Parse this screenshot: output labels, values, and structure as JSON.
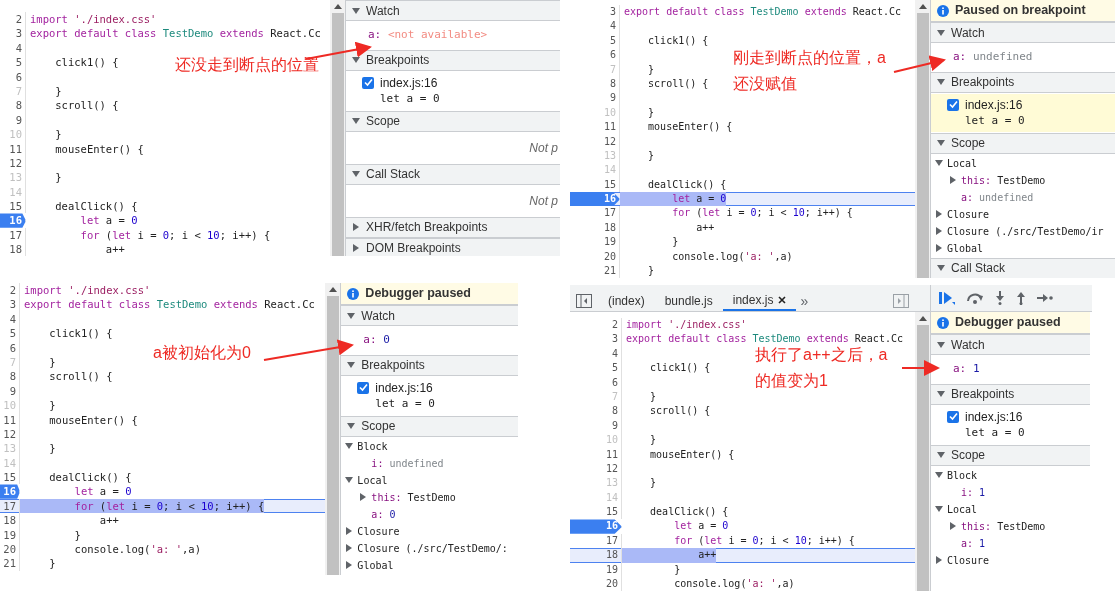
{
  "panels": [
    {
      "annotation": [
        "还没走到断点的位置"
      ],
      "code_lines": [
        {
          "number": "2",
          "dim": false,
          "breakpoint": false,
          "current": false,
          "code": [
            {
              "kind": "keyword",
              "text": "import "
            },
            {
              "kind": "string",
              "text": "'./index.css'"
            }
          ]
        },
        {
          "number": "3",
          "dim": false,
          "breakpoint": false,
          "current": false,
          "code": [
            {
              "kind": "keyword",
              "text": "export default class "
            },
            {
              "kind": "type",
              "text": "TestDemo "
            },
            {
              "kind": "keyword",
              "text": "extends "
            },
            {
              "kind": "plain",
              "text": "React.Cc"
            }
          ]
        },
        {
          "number": "4",
          "dim": false,
          "breakpoint": false,
          "current": false
        },
        {
          "number": "5",
          "dim": false,
          "breakpoint": false,
          "current": false,
          "code": [
            {
              "kind": "plain",
              "text": "    click1() {"
            }
          ]
        },
        {
          "number": "6",
          "dim": false,
          "breakpoint": false,
          "current": false
        },
        {
          "number": "7",
          "dim": true,
          "breakpoint": false,
          "current": false,
          "code": [
            {
              "kind": "plain",
              "text": "    }"
            }
          ]
        },
        {
          "number": "8",
          "dim": false,
          "breakpoint": false,
          "current": false,
          "code": [
            {
              "kind": "plain",
              "text": "    scroll() {"
            }
          ]
        },
        {
          "number": "9",
          "dim": false,
          "breakpoint": false,
          "current": false
        },
        {
          "number": "10",
          "dim": true,
          "breakpoint": false,
          "current": false,
          "code": [
            {
              "kind": "plain",
              "text": "    }"
            }
          ]
        },
        {
          "number": "11",
          "dim": false,
          "breakpoint": false,
          "current": false,
          "code": [
            {
              "kind": "plain",
              "text": "    mouseEnter() {"
            }
          ]
        },
        {
          "number": "12",
          "dim": false,
          "breakpoint": false,
          "current": false
        },
        {
          "number": "13",
          "dim": true,
          "breakpoint": false,
          "current": false,
          "code": [
            {
              "kind": "plain",
              "text": "    }"
            }
          ]
        },
        {
          "number": "14",
          "dim": true,
          "breakpoint": false,
          "current": false
        },
        {
          "number": "15",
          "dim": false,
          "breakpoint": false,
          "current": false,
          "code": [
            {
              "kind": "plain",
              "text": "    dealClick() {"
            }
          ]
        },
        {
          "number": "16",
          "dim": false,
          "breakpoint": true,
          "current": false,
          "code": [
            {
              "kind": "keyword",
              "text": "        let "
            },
            {
              "kind": "plain",
              "text": "a = "
            },
            {
              "kind": "number",
              "text": "0"
            }
          ]
        },
        {
          "number": "17",
          "dim": false,
          "breakpoint": false,
          "current": false,
          "code": [
            {
              "kind": "keyword",
              "text": "        for "
            },
            {
              "kind": "plain",
              "text": "("
            },
            {
              "kind": "keyword",
              "text": "let "
            },
            {
              "kind": "plain",
              "text": "i = "
            },
            {
              "kind": "number",
              "text": "0"
            },
            {
              "kind": "plain",
              "text": "; i < "
            },
            {
              "kind": "number",
              "text": "10"
            },
            {
              "kind": "plain",
              "text": "; i++) {"
            }
          ]
        },
        {
          "number": "18",
          "dim": false,
          "breakpoint": false,
          "current": false,
          "code": [
            {
              "kind": "plain",
              "text": "            a++"
            }
          ]
        }
      ],
      "sections": [
        {
          "title": "Watch",
          "expanded": true,
          "items": [
            {
              "kind": "watch",
              "name": "a:",
              "value": {
                "kind": "unavailable",
                "text": "<not available>"
              }
            }
          ]
        },
        {
          "title": "Breakpoints",
          "expanded": true,
          "items": [
            {
              "kind": "breakpoint",
              "checked": true,
              "file": "index.js:16",
              "code": "let a = 0",
              "selected": false
            }
          ]
        },
        {
          "title": "Scope",
          "expanded": true,
          "items": [
            {
              "kind": "message",
              "text": "Not p"
            }
          ]
        },
        {
          "title": "Call Stack",
          "expanded": true,
          "items": [
            {
              "kind": "message",
              "text": "Not p"
            }
          ]
        },
        {
          "title": "XHR/fetch Breakpoints",
          "expanded": false
        },
        {
          "title": "DOM Breakpoints",
          "expanded": false
        }
      ]
    },
    {
      "annotation": [
        "刚走到断点的位置，a",
        "还没赋值"
      ],
      "banner": "Paused on breakpoint",
      "code_lines": [
        {
          "number": "3",
          "dim": false,
          "breakpoint": false,
          "current": false,
          "code": [
            {
              "kind": "keyword",
              "text": "export default class "
            },
            {
              "kind": "type",
              "text": "TestDemo "
            },
            {
              "kind": "keyword",
              "text": "extends "
            },
            {
              "kind": "plain",
              "text": "React.Cc"
            }
          ]
        },
        {
          "number": "4",
          "dim": false,
          "breakpoint": false,
          "current": false
        },
        {
          "number": "5",
          "dim": false,
          "breakpoint": false,
          "current": false,
          "code": [
            {
              "kind": "plain",
              "text": "    click1() {"
            }
          ]
        },
        {
          "number": "6",
          "dim": false,
          "breakpoint": false,
          "current": false
        },
        {
          "number": "7",
          "dim": true,
          "breakpoint": false,
          "current": false,
          "code": [
            {
              "kind": "plain",
              "text": "    }"
            }
          ]
        },
        {
          "number": "8",
          "dim": false,
          "breakpoint": false,
          "current": false,
          "code": [
            {
              "kind": "plain",
              "text": "    scroll() {"
            }
          ]
        },
        {
          "number": "9",
          "dim": false,
          "breakpoint": false,
          "current": false
        },
        {
          "number": "10",
          "dim": true,
          "breakpoint": false,
          "current": false,
          "code": [
            {
              "kind": "plain",
              "text": "    }"
            }
          ]
        },
        {
          "number": "11",
          "dim": false,
          "breakpoint": false,
          "current": false,
          "code": [
            {
              "kind": "plain",
              "text": "    mouseEnter() {"
            }
          ]
        },
        {
          "number": "12",
          "dim": false,
          "breakpoint": false,
          "current": false
        },
        {
          "number": "13",
          "dim": true,
          "breakpoint": false,
          "current": false,
          "code": [
            {
              "kind": "plain",
              "text": "    }"
            }
          ]
        },
        {
          "number": "14",
          "dim": true,
          "breakpoint": false,
          "current": false
        },
        {
          "number": "15",
          "dim": false,
          "breakpoint": false,
          "current": false,
          "code": [
            {
              "kind": "plain",
              "text": "    dealClick() {"
            }
          ]
        },
        {
          "number": "16",
          "dim": false,
          "breakpoint": true,
          "current": true,
          "code": [
            {
              "kind": "keyword",
              "text": "        let "
            },
            {
              "kind": "plain",
              "text": "a = "
            },
            {
              "kind": "number",
              "text": "0"
            }
          ]
        },
        {
          "number": "17",
          "dim": false,
          "breakpoint": false,
          "current": false,
          "code": [
            {
              "kind": "keyword",
              "text": "        for "
            },
            {
              "kind": "plain",
              "text": "("
            },
            {
              "kind": "keyword",
              "text": "let "
            },
            {
              "kind": "plain",
              "text": "i = "
            },
            {
              "kind": "number",
              "text": "0"
            },
            {
              "kind": "plain",
              "text": "; i < "
            },
            {
              "kind": "number",
              "text": "10"
            },
            {
              "kind": "plain",
              "text": "; i++) {"
            }
          ]
        },
        {
          "number": "18",
          "dim": false,
          "breakpoint": false,
          "current": false,
          "code": [
            {
              "kind": "plain",
              "text": "            a++"
            }
          ]
        },
        {
          "number": "19",
          "dim": false,
          "breakpoint": false,
          "current": false,
          "code": [
            {
              "kind": "plain",
              "text": "        }"
            }
          ]
        },
        {
          "number": "20",
          "dim": false,
          "breakpoint": false,
          "current": false,
          "code": [
            {
              "kind": "plain",
              "text": "        console.log("
            },
            {
              "kind": "string",
              "text": "'a: '"
            },
            {
              "kind": "plain",
              "text": ",a)"
            }
          ]
        },
        {
          "number": "21",
          "dim": false,
          "breakpoint": false,
          "current": false,
          "code": [
            {
              "kind": "plain",
              "text": "    }"
            }
          ]
        }
      ],
      "sections": [
        {
          "title": "Watch",
          "expanded": true,
          "items": [
            {
              "kind": "watch",
              "name": "a:",
              "value": {
                "kind": "undefined",
                "text": "undefined"
              }
            }
          ]
        },
        {
          "title": "Breakpoints",
          "expanded": true,
          "items": [
            {
              "kind": "breakpoint",
              "checked": true,
              "file": "index.js:16",
              "code": "let a = 0",
              "selected": true
            }
          ]
        },
        {
          "title": "Scope",
          "expanded": true,
          "items": [
            {
              "kind": "scope",
              "label": "Local",
              "expanded": true,
              "children": [
                {
                  "name": "this:",
                  "value": {
                    "kind": "object",
                    "text": "TestDemo"
                  },
                  "expanded": false
                },
                {
                  "name": "a:",
                  "value": {
                    "kind": "undefined",
                    "text": "undefined"
                  }
                }
              ]
            },
            {
              "kind": "scope",
              "label": "Closure",
              "expanded": false
            },
            {
              "kind": "scope",
              "label": "Closure (./src/TestDemo/ir",
              "expanded": false
            },
            {
              "kind": "scope",
              "label": "Global",
              "expanded": false
            }
          ]
        },
        {
          "title": "Call Stack",
          "expanded": true
        }
      ]
    },
    {
      "annotation": [
        "a被初始化为0"
      ],
      "banner": "Debugger paused",
      "code_lines": [
        {
          "number": "2",
          "dim": false,
          "breakpoint": false,
          "current": false,
          "code": [
            {
              "kind": "keyword",
              "text": "import "
            },
            {
              "kind": "string",
              "text": "'./index.css'"
            }
          ]
        },
        {
          "number": "3",
          "dim": false,
          "breakpoint": false,
          "current": false,
          "code": [
            {
              "kind": "keyword",
              "text": "export default class "
            },
            {
              "kind": "type",
              "text": "TestDemo "
            },
            {
              "kind": "keyword",
              "text": "extends "
            },
            {
              "kind": "plain",
              "text": "React.Cc"
            }
          ]
        },
        {
          "number": "4",
          "dim": false,
          "breakpoint": false,
          "current": false
        },
        {
          "number": "5",
          "dim": false,
          "breakpoint": false,
          "current": false,
          "code": [
            {
              "kind": "plain",
              "text": "    click1() {"
            }
          ]
        },
        {
          "number": "6",
          "dim": false,
          "breakpoint": false,
          "current": false
        },
        {
          "number": "7",
          "dim": true,
          "breakpoint": false,
          "current": false,
          "code": [
            {
              "kind": "plain",
              "text": "    }"
            }
          ]
        },
        {
          "number": "8",
          "dim": false,
          "breakpoint": false,
          "current": false,
          "code": [
            {
              "kind": "plain",
              "text": "    scroll() {"
            }
          ]
        },
        {
          "number": "9",
          "dim": false,
          "breakpoint": false,
          "current": false
        },
        {
          "number": "10",
          "dim": true,
          "breakpoint": false,
          "current": false,
          "code": [
            {
              "kind": "plain",
              "text": "    }"
            }
          ]
        },
        {
          "number": "11",
          "dim": false,
          "breakpoint": false,
          "current": false,
          "code": [
            {
              "kind": "plain",
              "text": "    mouseEnter() {"
            }
          ]
        },
        {
          "number": "12",
          "dim": false,
          "breakpoint": false,
          "current": false
        },
        {
          "number": "13",
          "dim": true,
          "breakpoint": false,
          "current": false,
          "code": [
            {
              "kind": "plain",
              "text": "    }"
            }
          ]
        },
        {
          "number": "14",
          "dim": true,
          "breakpoint": false,
          "current": false
        },
        {
          "number": "15",
          "dim": false,
          "breakpoint": false,
          "current": false,
          "code": [
            {
              "kind": "plain",
              "text": "    dealClick() {"
            }
          ]
        },
        {
          "number": "16",
          "dim": false,
          "breakpoint": true,
          "current": false,
          "code": [
            {
              "kind": "keyword",
              "text": "        let "
            },
            {
              "kind": "plain",
              "text": "a = "
            },
            {
              "kind": "number",
              "text": "0"
            }
          ]
        },
        {
          "number": "17",
          "dim": false,
          "breakpoint": false,
          "current": true,
          "code": [
            {
              "kind": "keyword",
              "text": "        for "
            },
            {
              "kind": "plain",
              "text": "("
            },
            {
              "kind": "keyword",
              "text": "let "
            },
            {
              "kind": "plain",
              "text": "i = "
            },
            {
              "kind": "number",
              "text": "0"
            },
            {
              "kind": "plain",
              "text": "; i < "
            },
            {
              "kind": "number",
              "text": "10"
            },
            {
              "kind": "plain",
              "text": "; i++) {"
            }
          ]
        },
        {
          "number": "18",
          "dim": false,
          "breakpoint": false,
          "current": false,
          "code": [
            {
              "kind": "plain",
              "text": "            a++"
            }
          ]
        },
        {
          "number": "19",
          "dim": false,
          "breakpoint": false,
          "current": false,
          "code": [
            {
              "kind": "plain",
              "text": "        }"
            }
          ]
        },
        {
          "number": "20",
          "dim": false,
          "breakpoint": false,
          "current": false,
          "code": [
            {
              "kind": "plain",
              "text": "        console.log("
            },
            {
              "kind": "string",
              "text": "'a: '"
            },
            {
              "kind": "plain",
              "text": ",a)"
            }
          ]
        },
        {
          "number": "21",
          "dim": false,
          "breakpoint": false,
          "current": false,
          "code": [
            {
              "kind": "plain",
              "text": "    }"
            }
          ]
        }
      ],
      "sections": [
        {
          "title": "Watch",
          "expanded": true,
          "items": [
            {
              "kind": "watch",
              "name": "a:",
              "value": {
                "kind": "number",
                "text": "0"
              }
            }
          ]
        },
        {
          "title": "Breakpoints",
          "expanded": true,
          "items": [
            {
              "kind": "breakpoint",
              "checked": true,
              "file": "index.js:16",
              "code": "let a = 0",
              "selected": false
            }
          ]
        },
        {
          "title": "Scope",
          "expanded": true,
          "items": [
            {
              "kind": "scope",
              "label": "Block",
              "expanded": true,
              "children": [
                {
                  "name": "i:",
                  "value": {
                    "kind": "undefined",
                    "text": "undefined"
                  }
                }
              ]
            },
            {
              "kind": "scope",
              "label": "Local",
              "expanded": true,
              "children": [
                {
                  "name": "this:",
                  "value": {
                    "kind": "object",
                    "text": "TestDemo"
                  },
                  "expanded": false
                },
                {
                  "name": "a:",
                  "value": {
                    "kind": "number",
                    "text": "0"
                  }
                }
              ]
            },
            {
              "kind": "scope",
              "label": "Closure",
              "expanded": false
            },
            {
              "kind": "scope",
              "label": "Closure (./src/TestDemo/:",
              "expanded": false
            },
            {
              "kind": "scope",
              "label": "Global",
              "expanded": false
            }
          ]
        }
      ]
    },
    {
      "annotation": [
        "执行了a++之后，a",
        "的值变为1"
      ],
      "banner": "Debugger paused",
      "tabs": [
        {
          "label": "(index)",
          "selected": false,
          "closable": false
        },
        {
          "label": "bundle.js",
          "selected": false,
          "closable": false
        },
        {
          "label": "index.js",
          "selected": true,
          "closable": true
        }
      ],
      "more_tabs": "»",
      "code_lines": [
        {
          "number": "2",
          "dim": false,
          "breakpoint": false,
          "current": false,
          "code": [
            {
              "kind": "keyword",
              "text": "import "
            },
            {
              "kind": "string",
              "text": "'./index.css'"
            }
          ]
        },
        {
          "number": "3",
          "dim": false,
          "breakpoint": false,
          "current": false,
          "code": [
            {
              "kind": "keyword",
              "text": "export default class "
            },
            {
              "kind": "type",
              "text": "TestDemo "
            },
            {
              "kind": "keyword",
              "text": "extends "
            },
            {
              "kind": "plain",
              "text": "React.Cc"
            }
          ]
        },
        {
          "number": "4",
          "dim": false,
          "breakpoint": false,
          "current": false
        },
        {
          "number": "5",
          "dim": false,
          "breakpoint": false,
          "current": false,
          "code": [
            {
              "kind": "plain",
              "text": "    click1() {"
            }
          ]
        },
        {
          "number": "6",
          "dim": false,
          "breakpoint": false,
          "current": false
        },
        {
          "number": "7",
          "dim": true,
          "breakpoint": false,
          "current": false,
          "code": [
            {
              "kind": "plain",
              "text": "    }"
            }
          ]
        },
        {
          "number": "8",
          "dim": false,
          "breakpoint": false,
          "current": false,
          "code": [
            {
              "kind": "plain",
              "text": "    scroll() {"
            }
          ]
        },
        {
          "number": "9",
          "dim": false,
          "breakpoint": false,
          "current": false
        },
        {
          "number": "10",
          "dim": true,
          "breakpoint": false,
          "current": false,
          "code": [
            {
              "kind": "plain",
              "text": "    }"
            }
          ]
        },
        {
          "number": "11",
          "dim": false,
          "breakpoint": false,
          "current": false,
          "code": [
            {
              "kind": "plain",
              "text": "    mouseEnter() {"
            }
          ]
        },
        {
          "number": "12",
          "dim": false,
          "breakpoint": false,
          "current": false
        },
        {
          "number": "13",
          "dim": true,
          "breakpoint": false,
          "current": false,
          "code": [
            {
              "kind": "plain",
              "text": "    }"
            }
          ]
        },
        {
          "number": "14",
          "dim": true,
          "breakpoint": false,
          "current": false
        },
        {
          "number": "15",
          "dim": false,
          "breakpoint": false,
          "current": false,
          "code": [
            {
              "kind": "plain",
              "text": "    dealClick() {"
            }
          ]
        },
        {
          "number": "16",
          "dim": false,
          "breakpoint": true,
          "current": false,
          "code": [
            {
              "kind": "keyword",
              "text": "        let "
            },
            {
              "kind": "plain",
              "text": "a = "
            },
            {
              "kind": "number",
              "text": "0"
            }
          ]
        },
        {
          "number": "17",
          "dim": false,
          "breakpoint": false,
          "current": false,
          "code": [
            {
              "kind": "keyword",
              "text": "        for "
            },
            {
              "kind": "plain",
              "text": "("
            },
            {
              "kind": "keyword",
              "text": "let "
            },
            {
              "kind": "plain",
              "text": "i = "
            },
            {
              "kind": "number",
              "text": "0"
            },
            {
              "kind": "plain",
              "text": "; i < "
            },
            {
              "kind": "number",
              "text": "10"
            },
            {
              "kind": "plain",
              "text": "; i++) {"
            }
          ]
        },
        {
          "number": "18",
          "dim": false,
          "breakpoint": false,
          "current": true,
          "code": [
            {
              "kind": "plain",
              "text": "            a++"
            }
          ]
        },
        {
          "number": "19",
          "dim": false,
          "breakpoint": false,
          "current": false,
          "code": [
            {
              "kind": "plain",
              "text": "        }"
            }
          ]
        },
        {
          "number": "20",
          "dim": false,
          "breakpoint": false,
          "current": false,
          "code": [
            {
              "kind": "plain",
              "text": "        console.log("
            },
            {
              "kind": "string",
              "text": "'a: '"
            },
            {
              "kind": "plain",
              "text": ",a)"
            }
          ]
        }
      ],
      "sections": [
        {
          "title": "Watch",
          "expanded": true,
          "items": [
            {
              "kind": "watch",
              "name": "a:",
              "value": {
                "kind": "number",
                "text": "1"
              }
            }
          ]
        },
        {
          "title": "Breakpoints",
          "expanded": true,
          "items": [
            {
              "kind": "breakpoint",
              "checked": true,
              "file": "index.js:16",
              "code": "let a = 0",
              "selected": false
            }
          ]
        },
        {
          "title": "Scope",
          "expanded": true,
          "items": [
            {
              "kind": "scope",
              "label": "Block",
              "expanded": true,
              "children": [
                {
                  "name": "i:",
                  "value": {
                    "kind": "number",
                    "text": "1"
                  }
                }
              ]
            },
            {
              "kind": "scope",
              "label": "Local",
              "expanded": true,
              "children": [
                {
                  "name": "this:",
                  "value": {
                    "kind": "object",
                    "text": "TestDemo"
                  },
                  "expanded": false
                },
                {
                  "name": "a:",
                  "value": {
                    "kind": "number",
                    "text": "1"
                  }
                }
              ]
            },
            {
              "kind": "scope",
              "label": "Closure",
              "expanded": false
            }
          ]
        }
      ]
    }
  ]
}
